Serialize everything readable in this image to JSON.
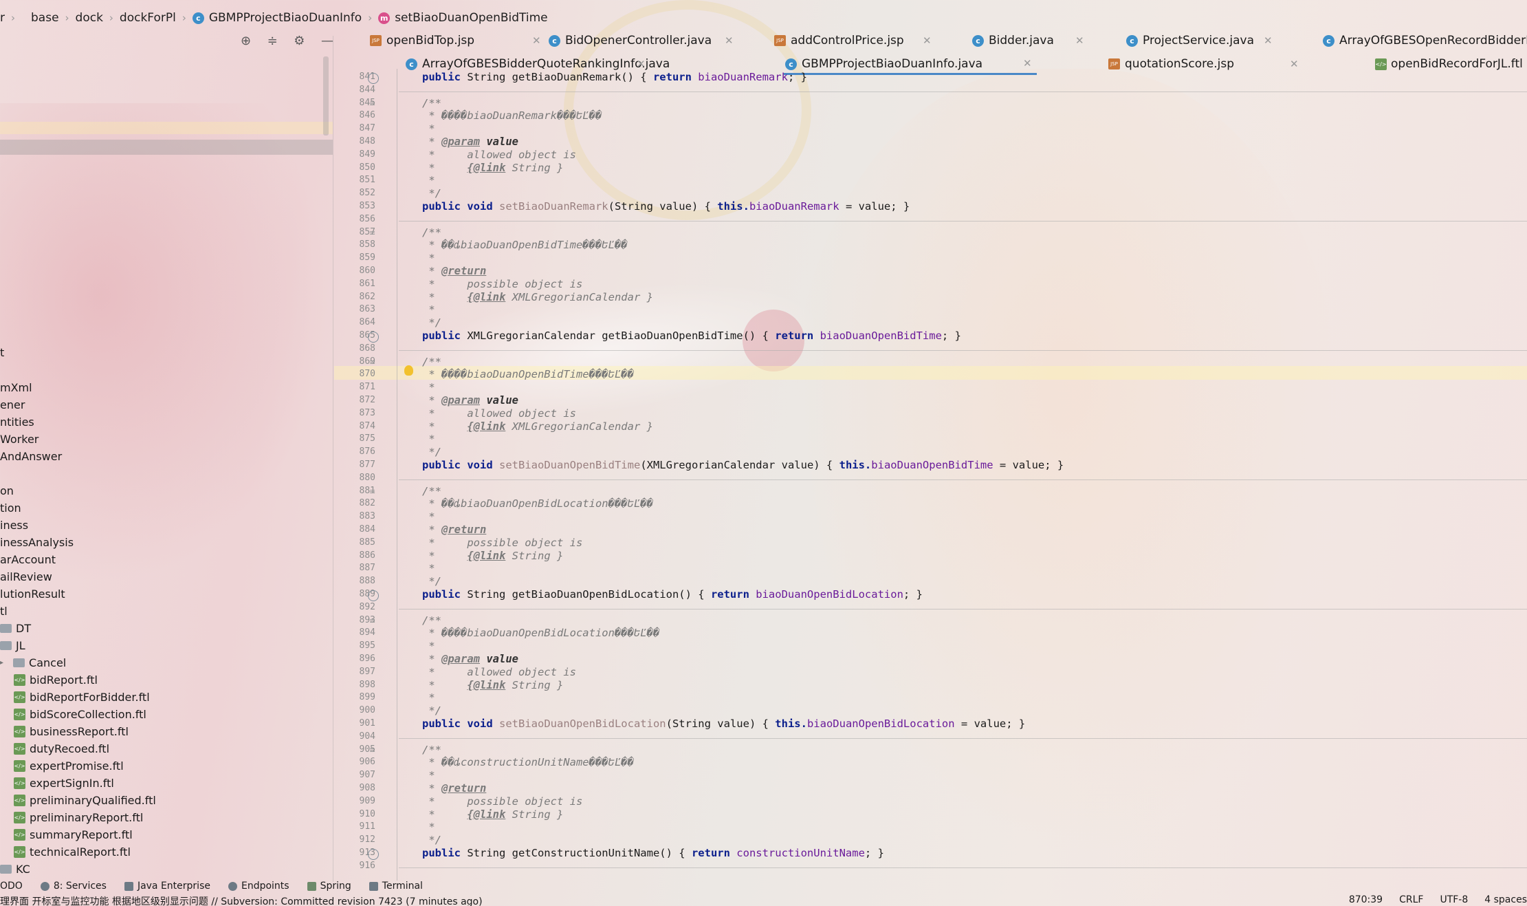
{
  "breadcrumb": [
    "r",
    "base",
    "dock",
    "dockForPl",
    "GBMPProjectBiaoDuanInfo",
    "setBiaoDuanOpenBidTime"
  ],
  "tabs_row1": [
    {
      "label": "openBidTop.jsp",
      "type": "jsp"
    },
    {
      "label": "BidOpenerController.java",
      "type": "class"
    },
    {
      "label": "addControlPrice.jsp",
      "type": "jsp"
    },
    {
      "label": "Bidder.java",
      "type": "class"
    },
    {
      "label": "ProjectService.java",
      "type": "class"
    },
    {
      "label": "ArrayOfGBESOpenRecordBidderInfo.java",
      "type": "class"
    }
  ],
  "tabs_row2": [
    {
      "label": "ArrayOfGBESBidderQuoteRankingInfo.java",
      "type": "class"
    },
    {
      "label": "GBMPProjectBiaoDuanInfo.java",
      "type": "class",
      "active": true
    },
    {
      "label": "quotationScore.jsp",
      "type": "jsp"
    },
    {
      "label": "openBidRecordForJL.ftl",
      "type": "ftl"
    }
  ],
  "tree": [
    "t",
    "mXml",
    "ener",
    "ntities",
    "Worker",
    "AndAnswer",
    "on",
    "tion",
    "iness",
    "inessAnalysis",
    "arAccount",
    "ailReview",
    "lutionResult",
    "tl",
    "DT",
    "JL",
    "Cancel",
    "bidReport.ftl",
    "bidReportForBidder.ftl",
    "bidScoreCollection.ftl",
    "businessReport.ftl",
    "dutyRecoed.ftl",
    "expertPromise.ftl",
    "expertSignIn.ftl",
    "preliminaryQualified.ftl",
    "preliminaryReport.ftl",
    "summaryReport.ftl",
    "technicalReport.ftl",
    "KC"
  ],
  "line_numbers": [
    "841",
    "844",
    "845",
    "846",
    "847",
    "848",
    "849",
    "850",
    "851",
    "852",
    "853",
    "856",
    "857",
    "858",
    "859",
    "860",
    "861",
    "862",
    "863",
    "864",
    "865",
    "868",
    "869",
    "870",
    "871",
    "872",
    "873",
    "874",
    "875",
    "876",
    "877",
    "880",
    "881",
    "882",
    "883",
    "884",
    "885",
    "886",
    "887",
    "888",
    "889",
    "892",
    "893",
    "894",
    "895",
    "896",
    "897",
    "898",
    "899",
    "900",
    "901",
    "904",
    "905",
    "906",
    "907",
    "908",
    "909",
    "910",
    "911",
    "912",
    "913",
    "916"
  ],
  "code": {
    "l841": [
      "public ",
      "String getBiaoDuanRemark() { ",
      "return ",
      "biaoDuanRemark",
      "; }"
    ],
    "l845": "/**",
    "l846": " * ����biaoDuanRemark���ԵĽ��",
    "l847": " *",
    "l848": [
      "@param",
      "value"
    ],
    "l849": " *     allowed object is",
    "l850": [
      "{@link",
      "String }"
    ],
    "l851": " *",
    "l852": " */",
    "l853": [
      "public ",
      "void ",
      "setBiaoDuanRemark",
      "(String value) { ",
      "this.",
      "biaoDuanRemark",
      " = value; }"
    ],
    "l857": "/**",
    "l858": " * ��ȡbiaoDuanOpenBidTime���ԵĽ��",
    "l859": " *",
    "l860": "@return",
    "l861": " *     possible object is",
    "l862": [
      "{@link",
      "XMLGregorianCalendar }"
    ],
    "l863": " *",
    "l864": " */",
    "l865": [
      "public ",
      "XMLGregorianCalendar getBiaoDuanOpenBidTime() { ",
      "return ",
      "biaoDuanOpenBidTime",
      "; }"
    ],
    "l869": "/**",
    "l870": " * ����biaoDuanOpenBidTime���ԵĽ��",
    "l871": " *",
    "l872": [
      "@param",
      "value"
    ],
    "l873": " *     allowed object is",
    "l874": [
      "{@link",
      "XMLGregorianCalendar }"
    ],
    "l875": " *",
    "l876": " */",
    "l877": [
      "public ",
      "void ",
      "setBiaoDuanOpenBidTime",
      "(XMLGregorianCalendar value) { ",
      "this.",
      "biaoDuanOpenBidTime",
      " = value; }"
    ],
    "l881": "/**",
    "l882": " * ��ȡbiaoDuanOpenBidLocation���ԵĽ��",
    "l883": " *",
    "l884": "@return",
    "l885": " *     possible object is",
    "l886": [
      "{@link",
      "String }"
    ],
    "l887": " *",
    "l888": " */",
    "l889": [
      "public ",
      "String getBiaoDuanOpenBidLocation() { ",
      "return ",
      "biaoDuanOpenBidLocation",
      "; }"
    ],
    "l893": "/**",
    "l894": " * ����biaoDuanOpenBidLocation���ԵĽ��",
    "l895": " *",
    "l896": [
      "@param",
      "value"
    ],
    "l897": " *     allowed object is",
    "l898": [
      "{@link",
      "String }"
    ],
    "l899": " *",
    "l900": " */",
    "l901": [
      "public ",
      "void ",
      "setBiaoDuanOpenBidLocation",
      "(String value) { ",
      "this.",
      "biaoDuanOpenBidLocation",
      " = value; }"
    ],
    "l905": "/**",
    "l906": " * ��ȡconstructionUnitName���ԵĽ��",
    "l907": " *",
    "l908": "@return",
    "l909": " *     possible object is",
    "l910": [
      "{@link",
      "String }"
    ],
    "l911": " *",
    "l912": " */",
    "l913": [
      "public ",
      "String getConstructionUnitName() { ",
      "return ",
      "constructionUnitName",
      "; }"
    ]
  },
  "toolwindows": [
    {
      "label": "ODO",
      "icon": "todo-icon"
    },
    {
      "label": "8: Services",
      "icon": "services-icon"
    },
    {
      "label": "Java Enterprise",
      "icon": "java-enterprise-icon"
    },
    {
      "label": "Endpoints",
      "icon": "endpoints-icon"
    },
    {
      "label": "Spring",
      "icon": "spring-icon"
    },
    {
      "label": "Terminal",
      "icon": "terminal-icon"
    }
  ],
  "status": {
    "message": "理界面 开标室与监控功能   根据地区级别显示问题 // Subversion: Committed revision 7423 (7 minutes ago)",
    "position": "870:39",
    "line_sep": "CRLF",
    "encoding": "UTF-8",
    "indent": "4 spaces"
  }
}
